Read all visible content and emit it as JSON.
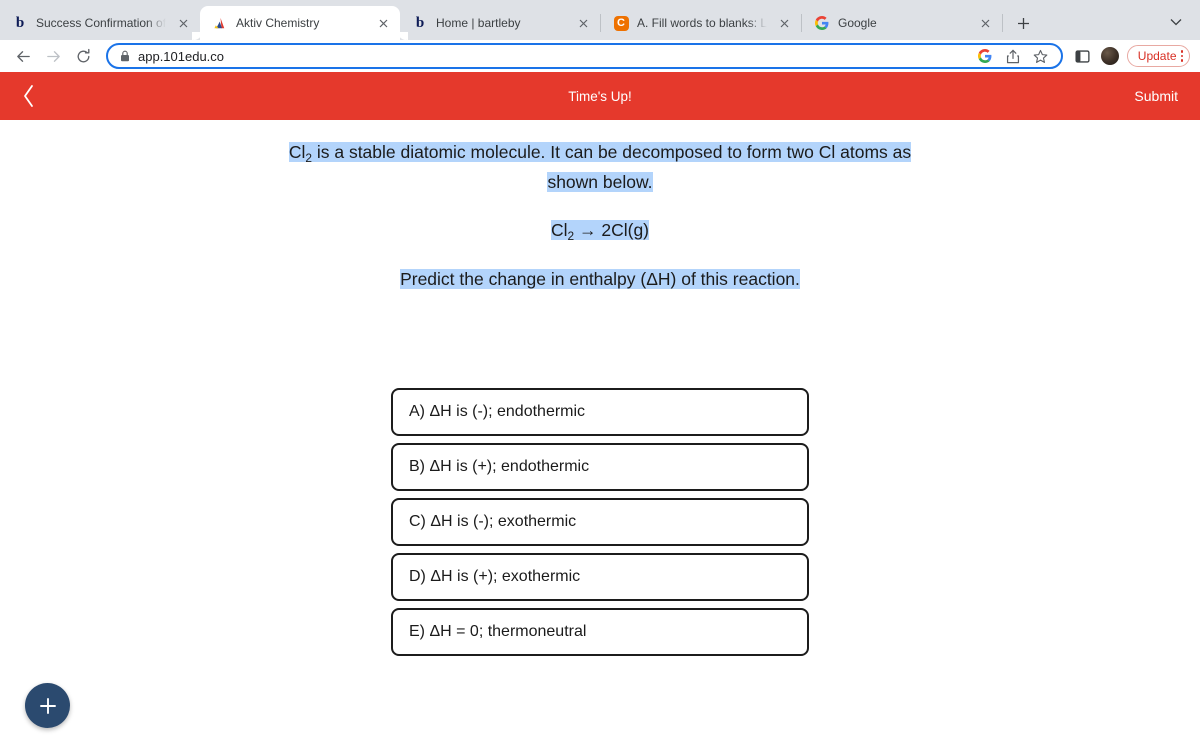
{
  "browser": {
    "tabs": [
      {
        "title": "Success Confirmation of Question",
        "favicon": "bartleby-b-icon",
        "active": false
      },
      {
        "title": "Aktiv Chemistry",
        "favicon": "aktiv-logo-icon",
        "active": true
      },
      {
        "title": "Home | bartleby",
        "favicon": "bartleby-b-icon",
        "active": false
      },
      {
        "title": "A. Fill words to blanks:  Longev",
        "favicon": "chegg-c-icon",
        "active": false
      },
      {
        "title": "Google",
        "favicon": "google-g-icon",
        "active": false
      }
    ],
    "new_tab_label": "+",
    "toolbar": {
      "back_icon": "back-arrow-icon",
      "forward_icon": "forward-arrow-icon",
      "reload_icon": "reload-icon",
      "lock_icon": "lock-icon",
      "url": "app.101edu.co",
      "google_icon": "google-g-icon",
      "share_icon": "share-icon",
      "bookmark_icon": "star-icon",
      "sidebar_icon": "sidebar-panel-icon",
      "avatar_icon": "profile-avatar",
      "update_label": "Update",
      "menu_icon": "kebab-menu-icon"
    }
  },
  "app": {
    "header": {
      "back_icon": "chevron-left-icon",
      "title": "Time's Up!",
      "submit_label": "Submit",
      "background_color": "#e5392c"
    },
    "question": {
      "line1_a": "Cl",
      "line1_sub": "2",
      "line1_b": " is a stable diatomic molecule. It can be decomposed to form two Cl atoms as shown below.",
      "equation_a": "Cl",
      "equation_sub": "2",
      "equation_b": " → 2Cl(g)",
      "predict": "Predict the change in enthalpy (ΔH) of this reaction.",
      "highlight_color": "#b3d4fb"
    },
    "options": [
      "A) ΔH is (-); endothermic",
      "B) ΔH is (+); endothermic",
      "C) ΔH is (-); exothermic",
      "D) ΔH is (+); exothermic",
      "E) ΔH = 0; thermoneutral"
    ],
    "fab": {
      "icon": "plus-icon",
      "color": "#2b4a6f"
    }
  }
}
